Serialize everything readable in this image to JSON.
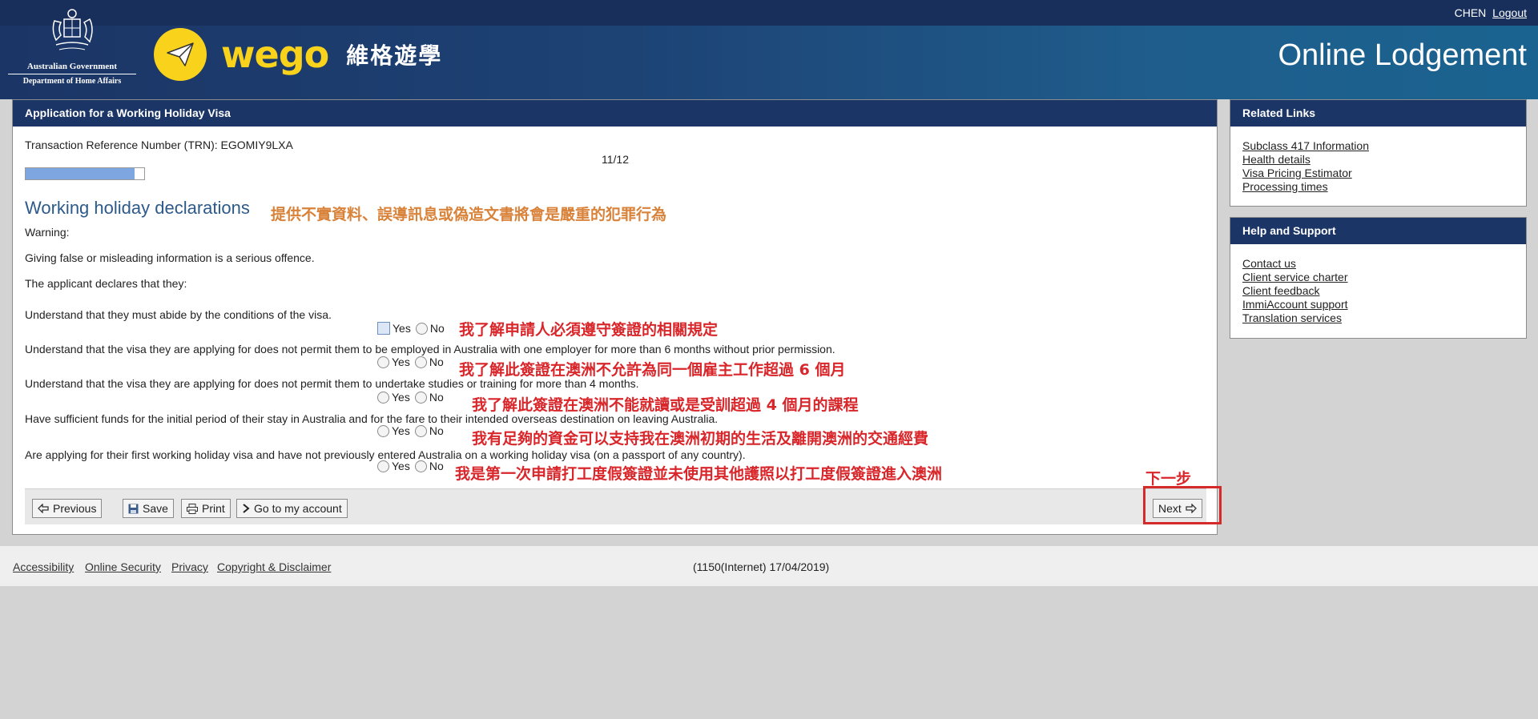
{
  "header": {
    "gov_line1": "Australian Government",
    "gov_line2": "Department of Home Affairs",
    "brand": "wego",
    "brand_cn": "維格遊學",
    "user": "CHEN",
    "logout": "Logout",
    "title": "Online Lodgement"
  },
  "main": {
    "panel_title": "Application for a Working Holiday Visa",
    "trn": "Transaction Reference Number (TRN): EGOMIY9LXA",
    "step": "11/12",
    "progress_fraction": 0.917,
    "section_title": "Working holiday declarations",
    "section_annotation": "提供不實資料、誤導訊息或偽造文書將會是嚴重的犯罪行為",
    "warning": "Warning:",
    "warning_text": "Giving false or misleading information is a serious offence.",
    "declares": "The applicant declares that they:",
    "yes": "Yes",
    "no": "No",
    "questions": [
      {
        "text": "Understand that they must abide by the conditions of the visa.",
        "annotation": "我了解申請人必須遵守簽證的相關規定",
        "selected": "yes"
      },
      {
        "text": "Understand that the visa they are applying for does not permit them to be employed in Australia with one employer for more than 6 months without prior permission.",
        "annotation": "我了解此簽證在澳洲不允許為同一個雇主工作超過 6 個月",
        "selected": "none"
      },
      {
        "text": "Understand that the visa they are applying for does not permit them to undertake studies or training for more than 4 months.",
        "annotation": "我了解此簽證在澳洲不能就讀或是受訓超過 4 個月的課程",
        "selected": "none"
      },
      {
        "text": "Have sufficient funds for the initial period of their stay in Australia and for the fare to their intended overseas destination on leaving Australia.",
        "annotation": "我有足夠的資金可以支持我在澳洲初期的生活及離開澳洲的交通經費",
        "selected": "none"
      },
      {
        "text": "Are applying for their first working holiday visa and have not previously entered Australia on a working holiday visa (on a passport of any country).",
        "annotation": "我是第一次申請打工度假簽證並未使用其他護照以打工度假簽證進入澳洲",
        "selected": "none"
      }
    ],
    "next_annotation": "下一步",
    "buttons": {
      "previous": "Previous",
      "save": "Save",
      "print": "Print",
      "account": "Go to my account",
      "next": "Next"
    }
  },
  "sidebar": {
    "related_title": "Related Links",
    "related_links": [
      "Subclass 417 Information",
      "Health details",
      "Visa Pricing Estimator",
      "Processing times"
    ],
    "help_title": "Help and Support",
    "help_links": [
      "Contact us",
      "Client service charter",
      "Client feedback",
      "ImmiAccount support",
      "Translation services"
    ]
  },
  "footer": {
    "links": [
      "Accessibility",
      "Online Security",
      "Privacy",
      "Copyright & Disclaimer"
    ],
    "version": "(1150(Internet) 17/04/2019)"
  }
}
